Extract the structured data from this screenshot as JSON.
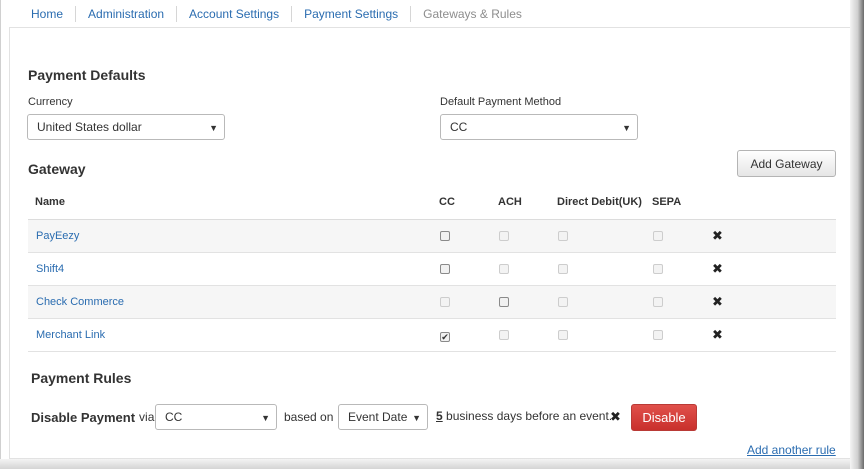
{
  "breadcrumb": [
    "Home",
    "Administration",
    "Account Settings",
    "Payment Settings",
    "Gateways & Rules"
  ],
  "defaults": {
    "title": "Payment Defaults",
    "currency_label": "Currency",
    "currency_value": "United States dollar",
    "method_label": "Default Payment Method",
    "method_value": "CC"
  },
  "gateway": {
    "title": "Gateway",
    "add_button": "Add Gateway",
    "columns": [
      "Name",
      "CC",
      "ACH",
      "Direct Debit(UK)",
      "SEPA"
    ],
    "rows": [
      {
        "name": "PayEezy",
        "cc": {
          "checked": false,
          "enabled": true
        },
        "ach": {
          "checked": false,
          "enabled": false
        },
        "dd": {
          "checked": false,
          "enabled": false
        },
        "sepa": {
          "checked": false,
          "enabled": false
        }
      },
      {
        "name": "Shift4",
        "cc": {
          "checked": false,
          "enabled": true
        },
        "ach": {
          "checked": false,
          "enabled": false
        },
        "dd": {
          "checked": false,
          "enabled": false
        },
        "sepa": {
          "checked": false,
          "enabled": false
        }
      },
      {
        "name": "Check Commerce",
        "cc": {
          "checked": false,
          "enabled": false
        },
        "ach": {
          "checked": false,
          "enabled": true
        },
        "dd": {
          "checked": false,
          "enabled": false
        },
        "sepa": {
          "checked": false,
          "enabled": false
        }
      },
      {
        "name": "Merchant Link",
        "cc": {
          "checked": true,
          "enabled": true
        },
        "ach": {
          "checked": false,
          "enabled": false
        },
        "dd": {
          "checked": false,
          "enabled": false
        },
        "sepa": {
          "checked": false,
          "enabled": false
        }
      }
    ],
    "remove_icon": "x-icon"
  },
  "rules": {
    "title": "Payment Rules",
    "disable_label": "Disable Payment",
    "via_text": "via",
    "method_value": "CC",
    "based_on_text": "based on",
    "event_value": "Event Date",
    "days_value": "5",
    "days_suffix": "business days before an event.",
    "disable_button": "Disable",
    "add_rule_link": "Add another rule"
  },
  "colors": {
    "link": "#2a6cb0",
    "danger": "#d9534f"
  }
}
